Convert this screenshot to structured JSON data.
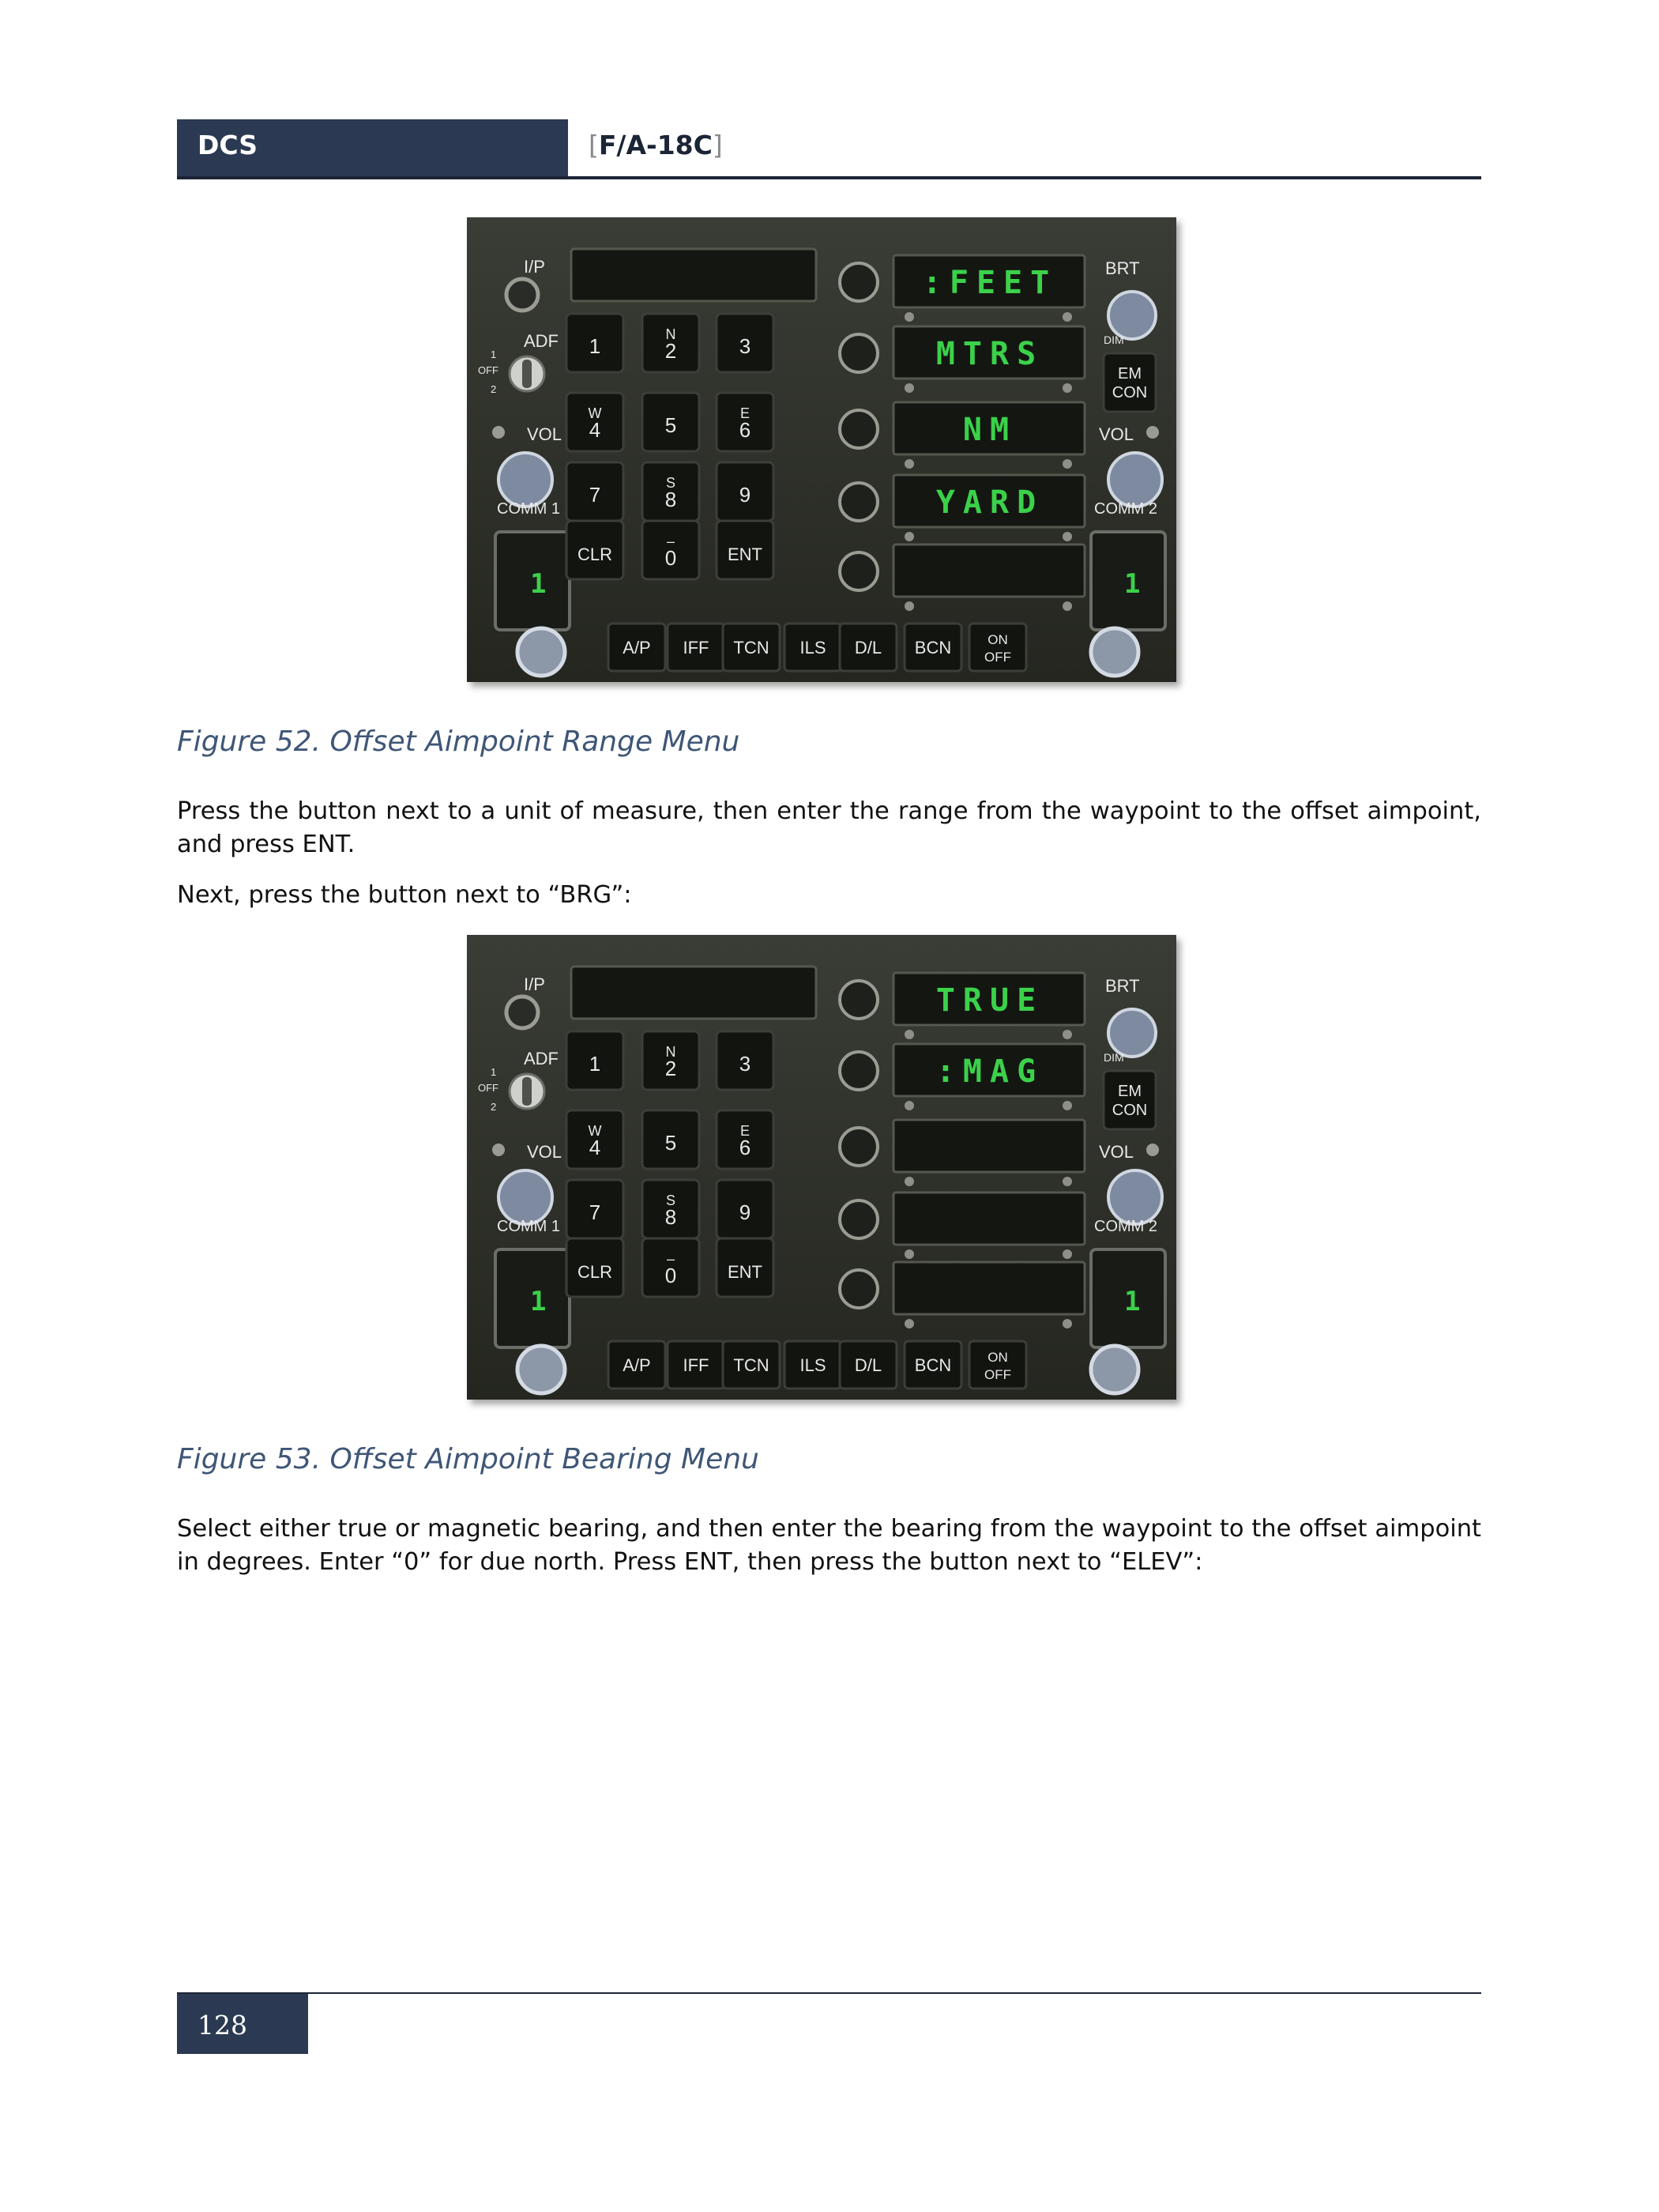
{
  "header": {
    "left": "DCS",
    "title_open": "[",
    "title": "F/A-18C",
    "title_close": "]"
  },
  "ufc_labels": {
    "ip": "I/P",
    "adf": "ADF",
    "adf_off": "OFF",
    "adf_1": "1",
    "adf_2": "2",
    "vol": "VOL",
    "comm1": "COMM 1",
    "comm2": "COMM 2",
    "brt": "BRT",
    "dim": "DIM",
    "emcon": [
      "EM",
      "CON"
    ],
    "keys": [
      {
        "top": "",
        "main": "1"
      },
      {
        "top": "N",
        "main": "2"
      },
      {
        "top": "",
        "main": "3"
      },
      {
        "top": "W",
        "main": "4"
      },
      {
        "top": "",
        "main": "5"
      },
      {
        "top": "E",
        "main": "6"
      },
      {
        "top": "",
        "main": "7"
      },
      {
        "top": "S",
        "main": "8"
      },
      {
        "top": "",
        "main": "9"
      },
      {
        "top": "",
        "main": "CLR"
      },
      {
        "top": "–",
        "main": "0"
      },
      {
        "top": "",
        "main": "ENT"
      }
    ],
    "bottom": [
      "A/P",
      "IFF",
      "TCN",
      "ILS",
      "D/L",
      "BCN"
    ],
    "onoff": [
      "ON",
      "OFF"
    ],
    "comm_readout": "1"
  },
  "figures": [
    {
      "options": [
        ":FEET",
        "MTRS",
        "NM",
        "YARD",
        ""
      ],
      "caption": "Figure 52. Offset Aimpoint Range Menu"
    },
    {
      "options": [
        "TRUE",
        ":MAG",
        "",
        "",
        ""
      ],
      "caption": "Figure 53. Offset Aimpoint Bearing Menu"
    }
  ],
  "paragraphs": [
    "Press the button next to a unit of measure, then enter the range from the waypoint to the offset aimpoint, and press ENT.",
    "Next, press the button next to “BRG”:",
    "Select either true or magnetic bearing, and then enter the bearing from the waypoint to the offset aimpoint in degrees. Enter “0” for due north. Press ENT, then press the button next to “ELEV”:"
  ],
  "footer": {
    "page": "128"
  },
  "colors": {
    "header_bg": "#2b3a52",
    "caption": "#3f5677",
    "display_green": "#3bd14a"
  }
}
